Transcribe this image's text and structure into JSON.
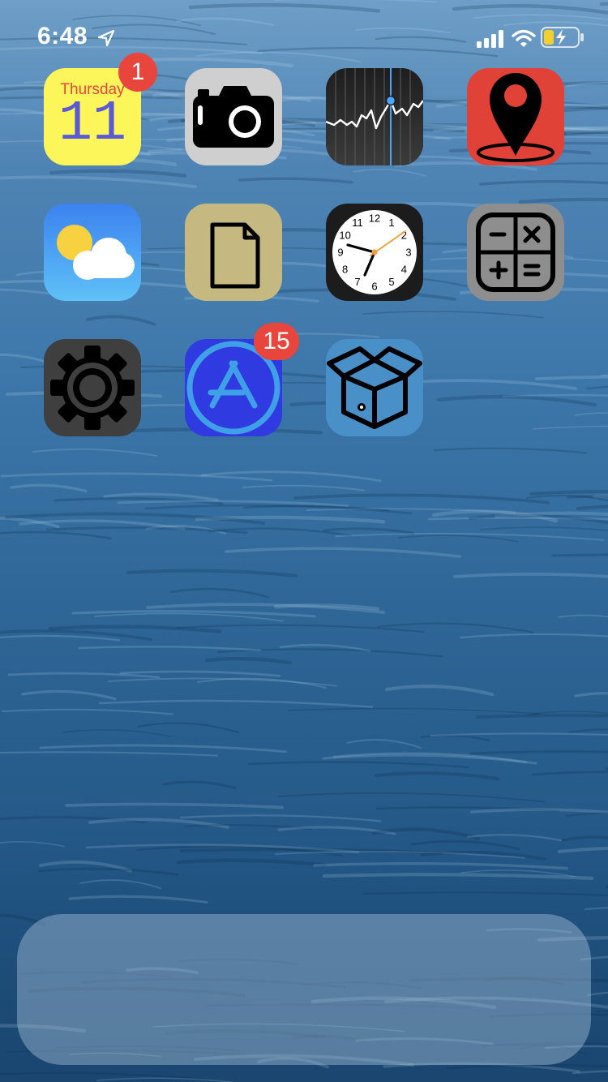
{
  "status_bar": {
    "time": "6:48",
    "location_icon": "location-arrow-icon",
    "signal_icon": "cellular-signal-icon",
    "wifi_icon": "wifi-icon",
    "battery_icon": "battery-charging-icon",
    "battery_fill_color": "#f5cf2e"
  },
  "apps": [
    {
      "name": "calendar",
      "icon": "calendar-icon",
      "day": "Thursday",
      "date": "11",
      "badge": "1",
      "bg": "#fdf65a"
    },
    {
      "name": "camera",
      "icon": "camera-icon",
      "bg": "#cfcfcf"
    },
    {
      "name": "stocks",
      "icon": "stocks-chart-icon",
      "bg": "#2a2a2a"
    },
    {
      "name": "maps",
      "icon": "map-pin-icon",
      "bg": "#e04237"
    },
    {
      "name": "weather",
      "icon": "weather-sun-cloud-icon",
      "bg": "#3f8ef0"
    },
    {
      "name": "files",
      "icon": "document-icon",
      "bg": "#c5b880"
    },
    {
      "name": "clock",
      "icon": "clock-icon",
      "bg": "#1c1c1c"
    },
    {
      "name": "calculator",
      "icon": "calculator-icon",
      "bg": "#8e8e8e"
    },
    {
      "name": "settings",
      "icon": "gear-icon",
      "bg": "#3f3f3f"
    },
    {
      "name": "app-store",
      "icon": "app-store-icon",
      "badge": "15",
      "bg": "#2f3be0"
    },
    {
      "name": "package",
      "icon": "open-box-icon",
      "bg": "#4a90c8"
    }
  ],
  "clock_numbers": [
    "12",
    "1",
    "2",
    "3",
    "4",
    "5",
    "6",
    "7",
    "8",
    "9",
    "10",
    "11"
  ],
  "colors": {
    "badge": "#e8453c",
    "clock_second_hand": "#f29c38",
    "stocks_highlight": "#4aa6ff"
  }
}
